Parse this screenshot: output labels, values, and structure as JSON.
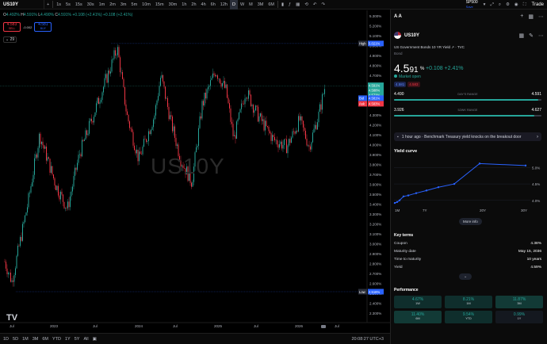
{
  "toolbar": {
    "symbol": "US10Y",
    "timeframes": [
      "1s",
      "5s",
      "15s",
      "30s",
      "1m",
      "2m",
      "3m",
      "5m",
      "10m",
      "15m",
      "30m",
      "1h",
      "2h",
      "4h",
      "6h",
      "12h",
      "D",
      "W",
      "M",
      "3M",
      "6M"
    ],
    "active_timeframe": "D",
    "compare_symbol": "SP500",
    "compare_label": "Save",
    "trade_label": "Trade"
  },
  "legend": {
    "o_label": "O",
    "o": "4.492%",
    "h_label": "H",
    "h": "4.591%",
    "l_label": "L",
    "l": "4.490%",
    "c_label": "C",
    "c": "4.591%",
    "change": "+0.108 (+2.41%)",
    "change2": "+0.108 (+2.41%)",
    "sell_price": "4.583",
    "sell_label": "SELL",
    "spread": "-0.002",
    "buy_price": "4.581",
    "buy_label": "BUY",
    "indicator_count": "29"
  },
  "chart": {
    "watermark": "US10Y",
    "price_axis": [
      "5.300%",
      "5.200%",
      "5.100%",
      "5.000%",
      "4.900%",
      "4.800%",
      "4.700%",
      "4.600%",
      "4.500%",
      "4.400%",
      "4.300%",
      "4.200%",
      "4.100%",
      "4.000%",
      "3.900%",
      "3.800%",
      "3.700%",
      "3.600%",
      "3.500%",
      "3.400%",
      "3.300%",
      "3.200%",
      "3.100%",
      "3.000%",
      "2.900%",
      "2.800%",
      "2.700%",
      "2.600%",
      "2.500%",
      "2.400%",
      "2.300%"
    ],
    "high_label": "High",
    "high_value": "5.021%",
    "low_label": "Low",
    "low_value": "2.516%",
    "last_price": "4.591%",
    "last_sub1": "4.588%",
    "last_sub2": "4.572%",
    "bid_label": "Bid",
    "bid_value": "4.581%",
    "ask_label": "Ask",
    "ask_value": "4.583%",
    "time_axis": [
      "Jul",
      "2023",
      "Jul",
      "2024",
      "Jul",
      "2025",
      "Jul",
      "2026",
      "Jul"
    ],
    "up_color": "#26a69a",
    "down_color": "#f23645"
  },
  "bottombar": {
    "ranges": [
      "1D",
      "5D",
      "1M",
      "3M",
      "6M",
      "YTD",
      "1Y",
      "5Y",
      "All"
    ],
    "clock": "20:08:27 UTC+3"
  },
  "panel": {
    "watchlist": "A A",
    "symbol": "US10Y",
    "full_name": "US Government Bonds 10 YR Yield",
    "source": "· TVC",
    "type": "Bond",
    "price_main": "4.5",
    "price_small": "91",
    "price_unit": "%",
    "change": "+0.108  +2.41%",
    "market_status": "Market open",
    "bid": "4.581",
    "ask": "4.583",
    "day_range": {
      "label": "DAY'S RANGE",
      "low": "4.490",
      "high": "4.591",
      "fill": 0.98
    },
    "week52_range": {
      "label": "52WK RANGE",
      "low": "3.926",
      "high": "4.627",
      "fill": 0.95
    },
    "news": "1 hour ago · Benchmark Treasury yield knocks on the breakout door",
    "yield_curve_title": "Yield curve",
    "yield_curve_y_labels": [
      "5.0%",
      "4.5%",
      "4.0%"
    ],
    "yield_curve_x_labels": [
      "1M",
      "7Y",
      "20Y",
      "30Y"
    ],
    "more_info": "More info",
    "key_terms_title": "Key terms",
    "key_terms": [
      {
        "k": "Coupon",
        "v": "4.38%"
      },
      {
        "k": "Maturity date",
        "v": "May 15, 2036"
      },
      {
        "k": "Time to maturity",
        "v": "10 years"
      },
      {
        "k": "Yield",
        "v": "4.59%"
      }
    ],
    "performance_title": "Performance",
    "performance": [
      {
        "v": "4.67%",
        "l": "1W"
      },
      {
        "v": "8.21%",
        "l": "1M"
      },
      {
        "v": "11.87%",
        "l": "3M"
      },
      {
        "v": "11.40%",
        "l": "6M"
      },
      {
        "v": "9.54%",
        "l": "YTD"
      },
      {
        "v": "0.99%",
        "l": "1Y"
      }
    ]
  }
}
